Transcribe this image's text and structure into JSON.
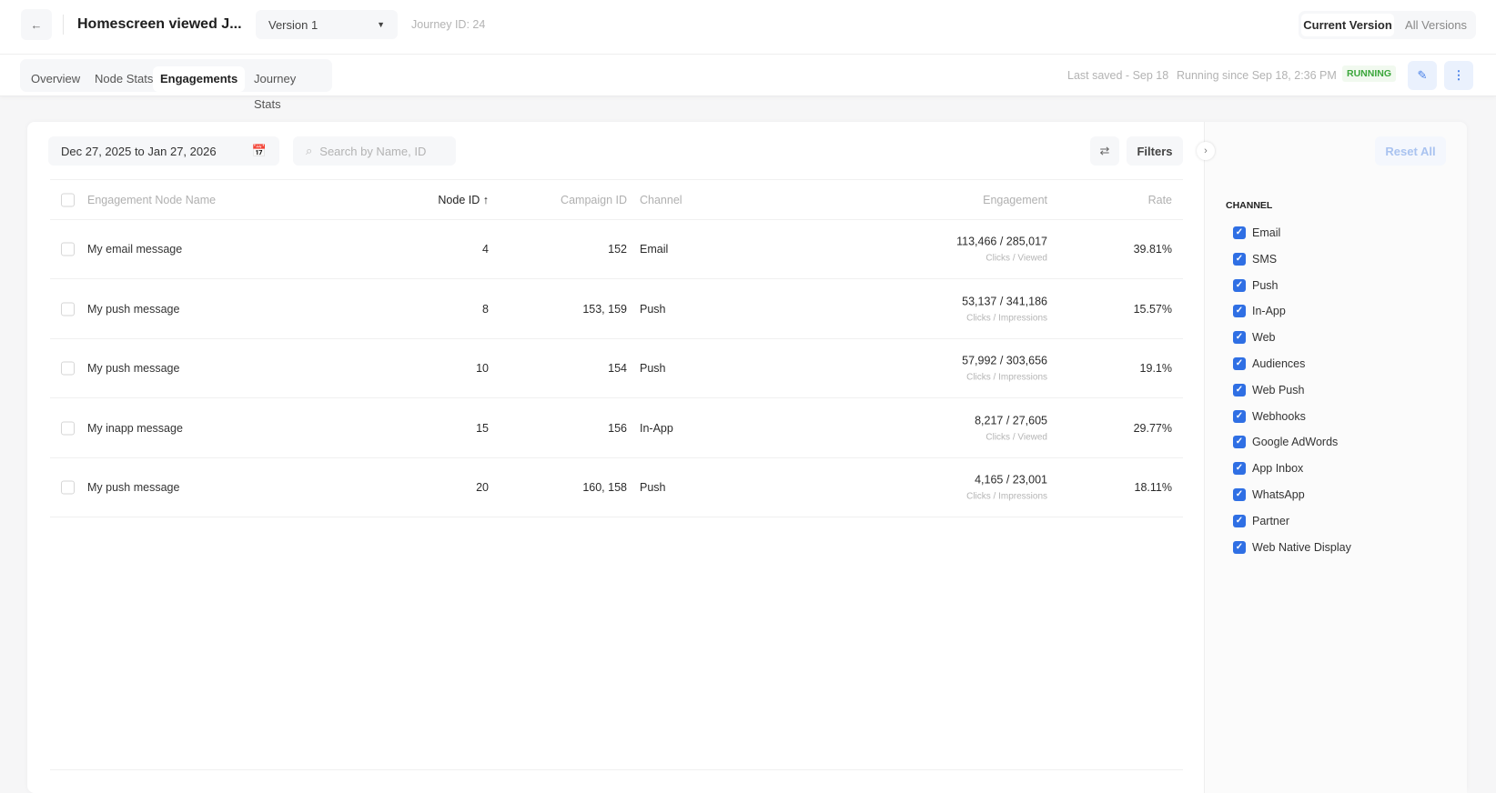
{
  "header": {
    "back_icon": "arrow-left-icon",
    "title": "Homescreen viewed J...",
    "version": "Version 1",
    "journey_id": "Journey ID: 24",
    "current_version": "Current Version",
    "all_versions": "All Versions"
  },
  "tabs": [
    "Overview",
    "Node Stats",
    "Engagements",
    "Journey Stats"
  ],
  "status": {
    "last_saved": "Last saved - Sep 18",
    "running_since": "Running since Sep 18, 2:36 PM",
    "badge": "RUNNING",
    "badge_color": "#3aa63a"
  },
  "toolbar": {
    "date_range": "Dec 27, 2025 to Jan 27, 2026",
    "search_placeholder": "Search by Name, ID",
    "filters": "Filters",
    "reset_all": "Reset All"
  },
  "table": {
    "columns": [
      "Engagement Node Name",
      "Node ID ↑",
      "Campaign ID",
      "Channel",
      "Engagement",
      "Rate"
    ],
    "rows": [
      {
        "name": "My email message",
        "node_id": "4",
        "campaign_id": "152",
        "channel": "Email",
        "engagement": "113,466 / 285,017",
        "engagement_label": "Clicks / Viewed",
        "rate": "39.81%"
      },
      {
        "name": "My push message",
        "node_id": "8",
        "campaign_id": "153, 159",
        "channel": "Push",
        "engagement": "53,137 / 341,186",
        "engagement_label": "Clicks / Impressions",
        "rate": "15.57%"
      },
      {
        "name": "My push message",
        "node_id": "10",
        "campaign_id": "154",
        "channel": "Push",
        "engagement": "57,992 / 303,656",
        "engagement_label": "Clicks / Impressions",
        "rate": "19.1%"
      },
      {
        "name": "My inapp message",
        "node_id": "15",
        "campaign_id": "156",
        "channel": "In-App",
        "engagement": "8,217 / 27,605",
        "engagement_label": "Clicks / Viewed",
        "rate": "29.77%"
      },
      {
        "name": "My push message",
        "node_id": "20",
        "campaign_id": "160, 158",
        "channel": "Push",
        "engagement": "4,165 / 23,001",
        "engagement_label": "Clicks / Impressions",
        "rate": "18.11%"
      }
    ]
  },
  "filter_panel": {
    "title": "CHANNEL",
    "accent": "#2f6fe4",
    "items": [
      "Email",
      "SMS",
      "Push",
      "In-App",
      "Web",
      "Audiences",
      "Web Push",
      "Webhooks",
      "Google AdWords",
      "App Inbox",
      "WhatsApp",
      "Partner",
      "Web Native Display"
    ]
  }
}
